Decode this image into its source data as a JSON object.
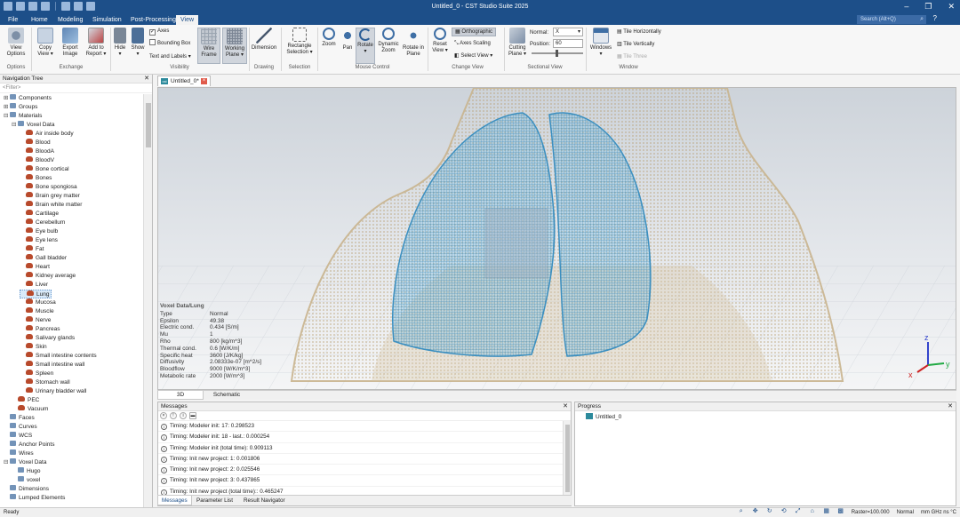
{
  "app": {
    "title": "Untitled_0 - CST Studio Suite 2025",
    "menu_tabs": [
      "File",
      "Home",
      "Modeling",
      "Simulation",
      "Post-Processing",
      "View"
    ],
    "search_placeholder": "Search (Alt+Q)",
    "accent": "#1d4f89"
  },
  "ribbon": {
    "view_options": {
      "label_1": "View",
      "label_2": "Options"
    },
    "copy_view": {
      "label_1": "Copy",
      "label_2": "View ▾"
    },
    "export_image": {
      "label_1": "Export",
      "label_2": "Image"
    },
    "add_report": {
      "label_1": "Add to",
      "label_2": "Report ▾"
    },
    "hide": {
      "label_1": "Hide",
      "label_2": "▾"
    },
    "show": {
      "label_1": "Show",
      "label_2": "▾"
    },
    "axes": "Axes",
    "bounding_box": "Bounding Box",
    "text_labels": "Text and Labels ▾",
    "wire_frame": {
      "label_1": "Wire",
      "label_2": "Frame"
    },
    "working_plane": {
      "label_1": "Working",
      "label_2": "Plane ▾"
    },
    "dimension": "Dimension",
    "rect_selection": {
      "label_1": "Rectangle",
      "label_2": "Selection ▾"
    },
    "zoom": "Zoom",
    "pan": "Pan",
    "rotate": "Rotate",
    "rotate_sub": "▾",
    "dynamic_zoom": {
      "label_1": "Dynamic",
      "label_2": "Zoom"
    },
    "rotate_in_plane": {
      "label_1": "Rotate in",
      "label_2": "Plane"
    },
    "reset_view": {
      "label_1": "Reset",
      "label_2": "View ▾"
    },
    "orthographic": "Orthographic",
    "axes_scaling": "Axes Scaling",
    "select_view": "Select View ▾",
    "cutting_plane": {
      "label_1": "Cutting",
      "label_2": "Plane ▾"
    },
    "normal_label": "Normal:",
    "normal_value": "X",
    "position_label": "Position:",
    "position_value": "60",
    "windows": {
      "label_1": "Windows",
      "label_2": "▾"
    },
    "tile_horizontally": "Tile Horizontally",
    "tile_vertically": "Tile Vertically",
    "tile_three": "Tile Three",
    "groups": [
      "Options",
      "Exchange",
      "Visibility",
      "Drawing",
      "Selection",
      "Mouse Control",
      "Change View",
      "Sectional View",
      "Window"
    ]
  },
  "nav": {
    "header": "Navigation Tree",
    "filter_placeholder": "<Filter>",
    "items": [
      {
        "label": "Components",
        "level": 0,
        "type": "folder",
        "toggle": "+"
      },
      {
        "label": "Groups",
        "level": 0,
        "type": "folder",
        "toggle": "+"
      },
      {
        "label": "Materials",
        "level": 0,
        "type": "folder",
        "toggle": "−"
      },
      {
        "label": "Voxel Data",
        "level": 1,
        "type": "folder",
        "toggle": "−"
      },
      {
        "label": "Air inside body",
        "level": 2,
        "type": "mat"
      },
      {
        "label": "Blood",
        "level": 2,
        "type": "mat"
      },
      {
        "label": "BloodA",
        "level": 2,
        "type": "mat"
      },
      {
        "label": "BloodV",
        "level": 2,
        "type": "mat"
      },
      {
        "label": "Bone cortical",
        "level": 2,
        "type": "mat"
      },
      {
        "label": "Bones",
        "level": 2,
        "type": "mat"
      },
      {
        "label": "Bone spongiosa",
        "level": 2,
        "type": "mat"
      },
      {
        "label": "Brain grey matter",
        "level": 2,
        "type": "mat"
      },
      {
        "label": "Brain white matter",
        "level": 2,
        "type": "mat"
      },
      {
        "label": "Cartilage",
        "level": 2,
        "type": "mat"
      },
      {
        "label": "Cerebellum",
        "level": 2,
        "type": "mat"
      },
      {
        "label": "Eye bulb",
        "level": 2,
        "type": "mat"
      },
      {
        "label": "Eye lens",
        "level": 2,
        "type": "mat"
      },
      {
        "label": "Fat",
        "level": 2,
        "type": "mat"
      },
      {
        "label": "Gall bladder",
        "level": 2,
        "type": "mat"
      },
      {
        "label": "Heart",
        "level": 2,
        "type": "mat"
      },
      {
        "label": "Kidney average",
        "level": 2,
        "type": "mat"
      },
      {
        "label": "Liver",
        "level": 2,
        "type": "mat"
      },
      {
        "label": "Lung",
        "level": 2,
        "type": "mat",
        "selected": true
      },
      {
        "label": "Mucosa",
        "level": 2,
        "type": "mat"
      },
      {
        "label": "Muscle",
        "level": 2,
        "type": "mat"
      },
      {
        "label": "Nerve",
        "level": 2,
        "type": "mat"
      },
      {
        "label": "Pancreas",
        "level": 2,
        "type": "mat"
      },
      {
        "label": "Salivary glands",
        "level": 2,
        "type": "mat"
      },
      {
        "label": "Skin",
        "level": 2,
        "type": "mat"
      },
      {
        "label": "Small intestine contents",
        "level": 2,
        "type": "mat"
      },
      {
        "label": "Small intestine wall",
        "level": 2,
        "type": "mat"
      },
      {
        "label": "Spleen",
        "level": 2,
        "type": "mat"
      },
      {
        "label": "Stomach wall",
        "level": 2,
        "type": "mat"
      },
      {
        "label": "Urinary bladder wall",
        "level": 2,
        "type": "mat"
      },
      {
        "label": "PEC",
        "level": 1,
        "type": "mat"
      },
      {
        "label": "Vacuum",
        "level": 1,
        "type": "mat"
      },
      {
        "label": "Faces",
        "level": 0,
        "type": "folder"
      },
      {
        "label": "Curves",
        "level": 0,
        "type": "folder"
      },
      {
        "label": "WCS",
        "level": 0,
        "type": "folder"
      },
      {
        "label": "Anchor Points",
        "level": 0,
        "type": "folder"
      },
      {
        "label": "Wires",
        "level": 0,
        "type": "folder"
      },
      {
        "label": "Voxel Data",
        "level": 0,
        "type": "folder",
        "toggle": "−"
      },
      {
        "label": "Hugo",
        "level": 1,
        "type": "folder"
      },
      {
        "label": "voxel",
        "level": 1,
        "type": "folder"
      },
      {
        "label": "Dimensions",
        "level": 0,
        "type": "folder"
      },
      {
        "label": "Lumped Elements",
        "level": 0,
        "type": "folder"
      }
    ]
  },
  "document": {
    "tab_label": "Untitled_0*",
    "icon_text": "cst"
  },
  "viewport": {
    "info_title": "Voxel Data/Lung",
    "props": [
      {
        "k": "Type",
        "v": "Normal"
      },
      {
        "k": "Epsilon",
        "v": "49.38"
      },
      {
        "k": "Electric cond.",
        "v": "0.434 [S/m]"
      },
      {
        "k": "Mu",
        "v": "1"
      },
      {
        "k": "Rho",
        "v": "800 [kg/m^3]"
      },
      {
        "k": "Thermal cond.",
        "v": "0.6 [W/K/m]"
      },
      {
        "k": "Specific heat",
        "v": "3600 [J/K/kg]"
      },
      {
        "k": "Diffusivity",
        "v": "2.08333e-07 [m^2/s]"
      },
      {
        "k": "Bloodflow",
        "v": "9000 [W/K/m^3]"
      },
      {
        "k": "Metabolic rate",
        "v": "2000 [W/m^3]"
      }
    ],
    "axis_x": "x",
    "axis_y": "y",
    "axis_z": "z",
    "tabs": [
      "3D",
      "Schematic"
    ],
    "body_color": "#c9b48e",
    "lung_color": "#4fa3cf"
  },
  "messages": {
    "header": "Messages",
    "lines": [
      "Timing: Modeler init: 17: 0.298523",
      "Timing: Modeler init: 18 - last.: 0.000254",
      "Timing: Modeler init (total time): 0.909113",
      "Timing: Init new project: 1: 0.001806",
      "Timing: Init new project: 2: 0.025546",
      "Timing: Init new project: 3: 0.437865",
      "Timing: Init new project (total time):: 0.465247"
    ],
    "tabs": [
      "Messages",
      "Parameter List",
      "Result Navigator"
    ]
  },
  "progress": {
    "header": "Progress",
    "item": "Untitled_0"
  },
  "status": {
    "left": "Ready",
    "raster": "Raster=100.000",
    "mode": "Normal",
    "units": "mm  GHz  ns  °C"
  }
}
